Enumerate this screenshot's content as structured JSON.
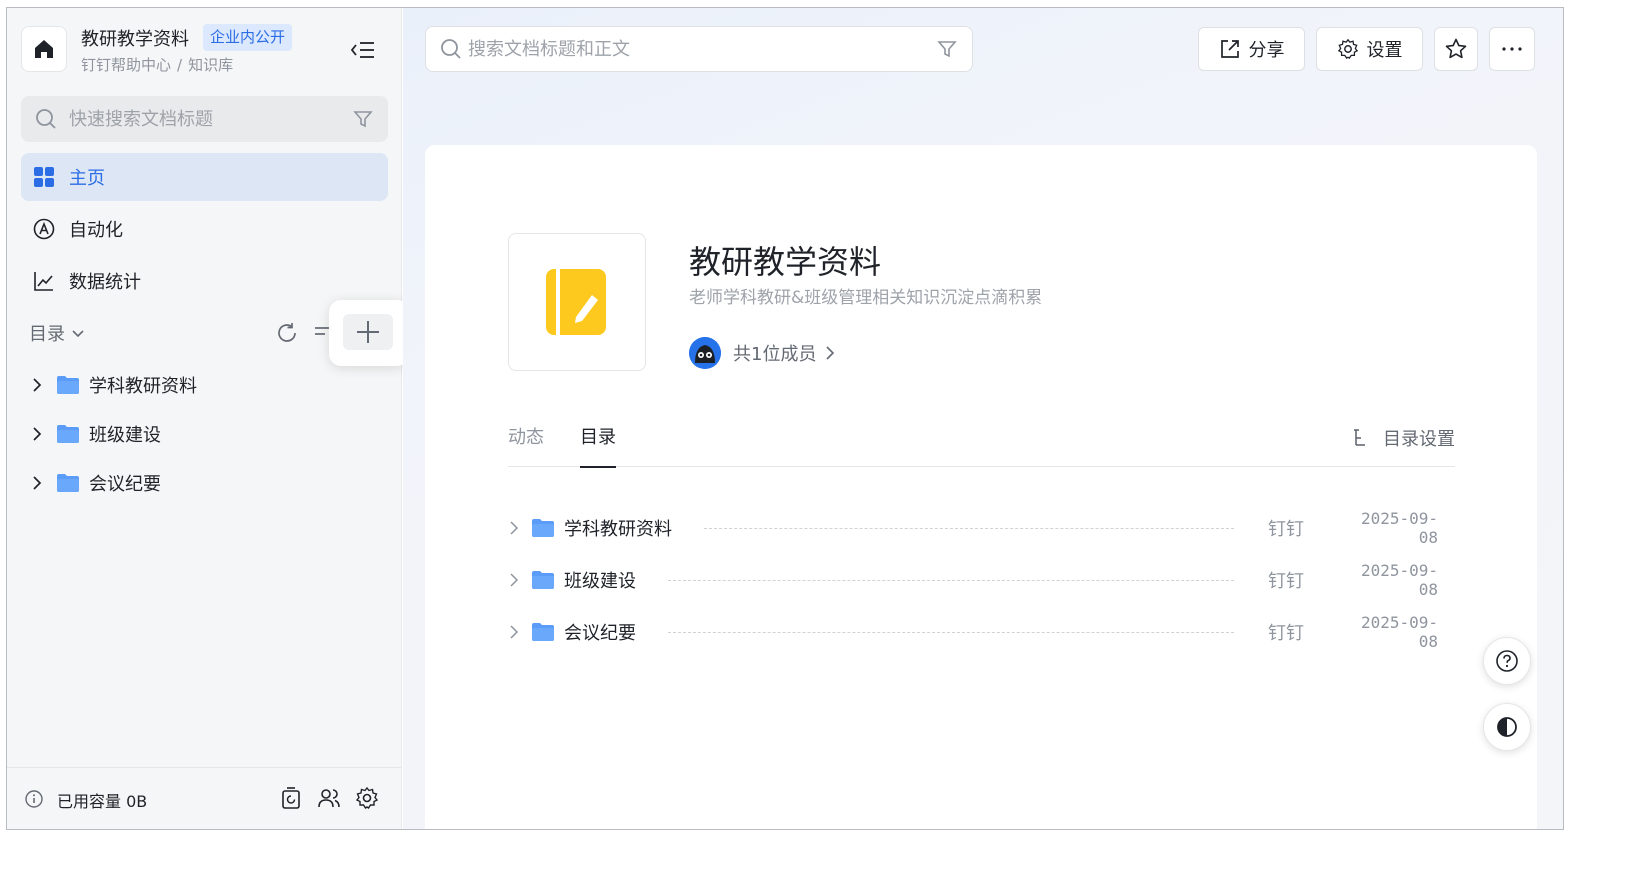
{
  "sidebar": {
    "kb_title": "教研教学资料",
    "kb_badge": "企业内公开",
    "breadcrumb": [
      "钉钉帮助中心",
      "/",
      "知识库"
    ],
    "search_placeholder": "快速搜索文档标题",
    "nav": [
      {
        "label": "主页",
        "icon": "grid-icon",
        "active": true
      },
      {
        "label": "自动化",
        "icon": "automation-icon",
        "active": false
      },
      {
        "label": "数据统计",
        "icon": "chart-icon",
        "active": false
      }
    ],
    "toc_label": "目录",
    "tree": [
      {
        "label": "学科教研资料"
      },
      {
        "label": "班级建设"
      },
      {
        "label": "会议纪要"
      }
    ],
    "footer_capacity": "已用容量 0B"
  },
  "header": {
    "search_placeholder": "搜索文档标题和正文",
    "share_label": "分享",
    "settings_label": "设置"
  },
  "main": {
    "title": "教研教学资料",
    "description": "老师学科教研&班级管理相关知识沉淀点滴积累",
    "members": "共1位成员",
    "tabs": [
      {
        "label": "动态",
        "active": false
      },
      {
        "label": "目录",
        "active": true
      }
    ],
    "toc_settings": "目录设置",
    "rows": [
      {
        "name": "学科教研资料",
        "owner": "钉钉",
        "date": "2025-09-08"
      },
      {
        "name": "班级建设",
        "owner": "钉钉",
        "date": "2025-09-08"
      },
      {
        "name": "会议纪要",
        "owner": "钉钉",
        "date": "2025-09-08"
      }
    ]
  },
  "colors": {
    "accent": "#2b6de5",
    "folder": "#5a9cf8",
    "cover": "#fdc91e"
  }
}
